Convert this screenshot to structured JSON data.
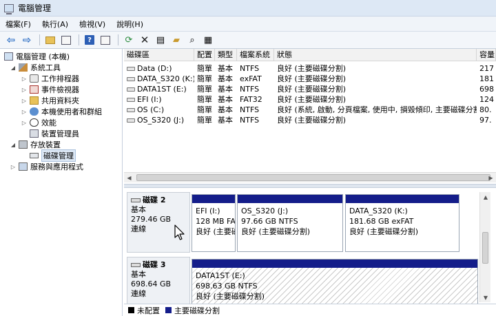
{
  "window": {
    "title": "電腦管理"
  },
  "menu": [
    "檔案(F)",
    "執行(A)",
    "檢視(V)",
    "說明(H)"
  ],
  "toolbar_icons": [
    "back-arrow-icon",
    "forward-arrow-icon",
    "folder-up-icon",
    "show-hide-tree-icon",
    "help-icon",
    "show-hide-action-icon",
    "refresh-icon",
    "delete-icon",
    "properties-icon",
    "open-folder-icon",
    "search-icon",
    "disk-properties-icon"
  ],
  "tree": {
    "root": "電腦管理 (本機)",
    "system_tools": "系統工具",
    "task_scheduler": "工作排程器",
    "event_viewer": "事件檢視器",
    "shared_folders": "共用資料夾",
    "local_users": "本機使用者和群組",
    "performance": "效能",
    "device_manager": "裝置管理員",
    "storage": "存放裝置",
    "disk_management": "磁碟管理",
    "services": "服務與應用程式"
  },
  "table": {
    "columns": [
      "磁碟區",
      "配置",
      "類型",
      "檔案系統",
      "狀態",
      "容量"
    ],
    "rows": [
      [
        "Data (D:)",
        "簡單",
        "基本",
        "NTFS",
        "良好 (主要磁碟分割)",
        "217"
      ],
      [
        "DATA_S320 (K:)",
        "簡單",
        "基本",
        "exFAT",
        "良好 (主要磁碟分割)",
        "181"
      ],
      [
        "DATA1ST (E:)",
        "簡單",
        "基本",
        "NTFS",
        "良好 (主要磁碟分割)",
        "698"
      ],
      [
        "EFI (I:)",
        "簡單",
        "基本",
        "FAT32",
        "良好 (主要磁碟分割)",
        "124"
      ],
      [
        "OS (C:)",
        "簡單",
        "基本",
        "NTFS",
        "良好 (系統, 啟動, 分頁檔案, 使用中, 損毀傾印, 主要磁碟分割)",
        "80."
      ],
      [
        "OS_S320 (J:)",
        "簡單",
        "基本",
        "NTFS",
        "良好 (主要磁碟分割)",
        "97."
      ]
    ]
  },
  "disks": [
    {
      "name": "磁碟 2",
      "type": "基本",
      "size": "279.46 GB",
      "status": "連線",
      "partitions": [
        {
          "name": "EFI  (I:)",
          "size": "128 MB FAT",
          "status": "良好 (主要磁"
        },
        {
          "name": "OS_S320  (J:)",
          "size": "97.66 GB NTFS",
          "status": "良好 (主要磁碟分割)"
        },
        {
          "name": "DATA_S320  (K:)",
          "size": "181.68 GB exFAT",
          "status": "良好 (主要磁碟分割)"
        }
      ]
    },
    {
      "name": "磁碟 3",
      "type": "基本",
      "size": "698.64 GB",
      "status": "連線",
      "partitions": [
        {
          "name": "DATA1ST  (E:)",
          "size": "698.63 GB NTFS",
          "status": "良好 (主要磁碟分割)"
        }
      ]
    }
  ],
  "legend": [
    {
      "label": "未配置",
      "color": "#000000"
    },
    {
      "label": "主要磁碟分割",
      "color": "#141d8a"
    }
  ]
}
